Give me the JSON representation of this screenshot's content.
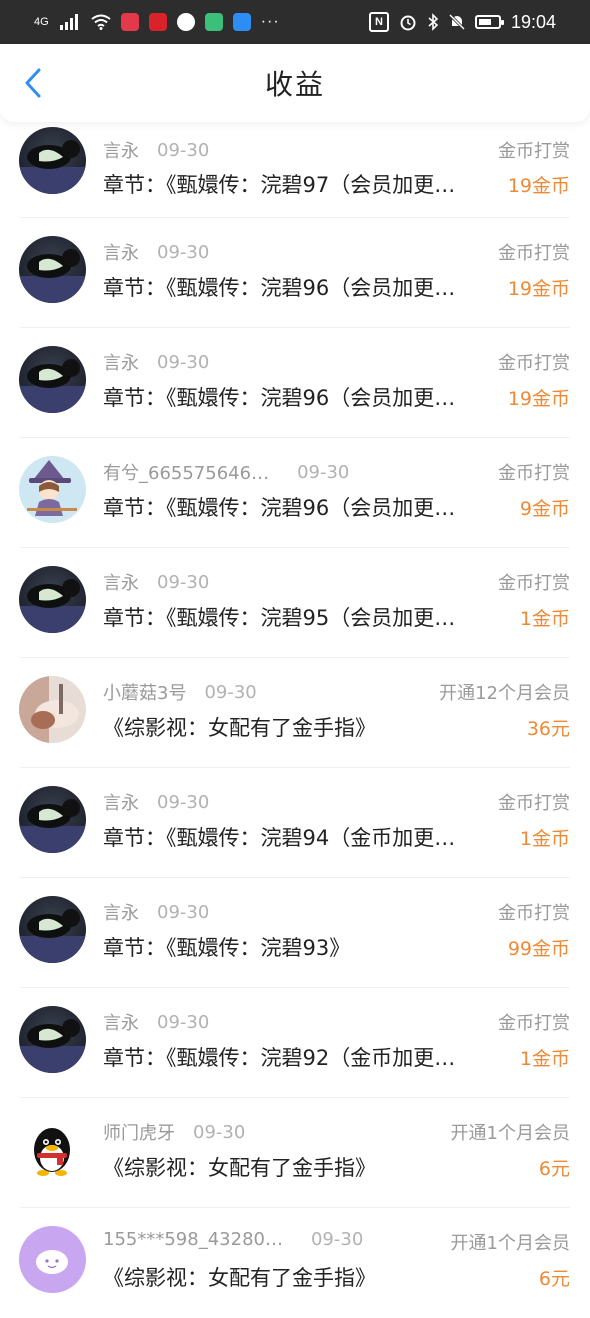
{
  "status_bar": {
    "network": "4G",
    "time": "19:04",
    "more": "···",
    "nfc_label": "N"
  },
  "header": {
    "title": "收益",
    "back_icon": "chevron-left-icon"
  },
  "colors": {
    "accent_amount": "#ee8a36",
    "back_blue": "#2f8ef0"
  },
  "rows": [
    {
      "name": "言永",
      "date": "09-30",
      "type": "金币打赏",
      "desc": "章节：《甄嬛传：浣碧97（会员加更…",
      "amount": "19金币",
      "avatar": "cat"
    },
    {
      "name": "言永",
      "date": "09-30",
      "type": "金币打赏",
      "desc": "章节：《甄嬛传：浣碧96（会员加更…",
      "amount": "19金币",
      "avatar": "cat"
    },
    {
      "name": "言永",
      "date": "09-30",
      "type": "金币打赏",
      "desc": "章节：《甄嬛传：浣碧96（会员加更…",
      "amount": "19金币",
      "avatar": "cat"
    },
    {
      "name": "有兮_665575646…",
      "date": "09-30",
      "type": "金币打赏",
      "desc": "章节：《甄嬛传：浣碧96（会员加更…",
      "amount": "9金币",
      "avatar": "witch"
    },
    {
      "name": "言永",
      "date": "09-30",
      "type": "金币打赏",
      "desc": "章节：《甄嬛传：浣碧95（会员加更…",
      "amount": "1金币",
      "avatar": "cat"
    },
    {
      "name": "小蘑菇3号",
      "date": "09-30",
      "type": "开通12个月会员",
      "desc": "《综影视：女配有了金手指》",
      "amount": "36元",
      "avatar": "photo"
    },
    {
      "name": "言永",
      "date": "09-30",
      "type": "金币打赏",
      "desc": "章节：《甄嬛传：浣碧94（金币加更…",
      "amount": "1金币",
      "avatar": "cat"
    },
    {
      "name": "言永",
      "date": "09-30",
      "type": "金币打赏",
      "desc": "章节：《甄嬛传：浣碧93》",
      "amount": "99金币",
      "avatar": "cat"
    },
    {
      "name": "言永",
      "date": "09-30",
      "type": "金币打赏",
      "desc": "章节：《甄嬛传：浣碧92（金币加更…",
      "amount": "1金币",
      "avatar": "cat"
    },
    {
      "name": "师门虎牙",
      "date": "09-30",
      "type": "开通1个月会员",
      "desc": "《综影视：女配有了金手指》",
      "amount": "6元",
      "avatar": "penguin"
    },
    {
      "name": "155***598_43280…",
      "date": "09-30",
      "type": "开通1个月会员",
      "desc": "《综影视：女配有了金手指》",
      "amount": "6元",
      "avatar": "purple"
    }
  ]
}
